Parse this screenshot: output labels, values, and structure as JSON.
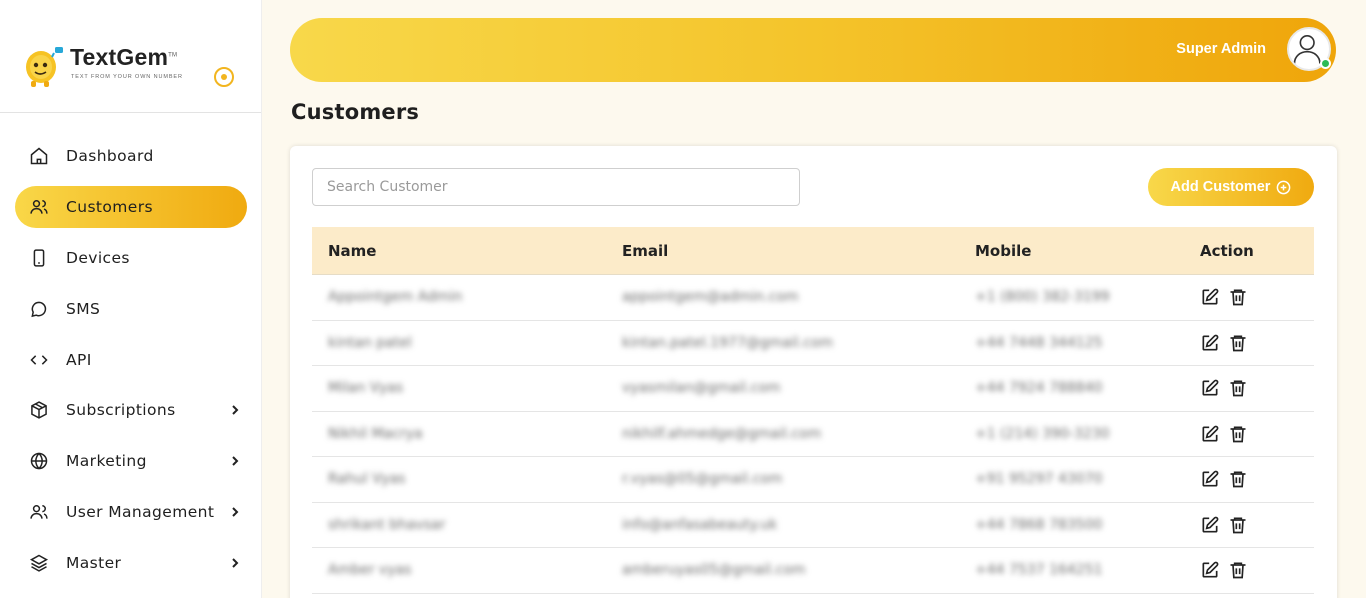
{
  "brand": {
    "name": "TextGem",
    "trademark": "TM",
    "tagline": "TEXT FROM YOUR OWN NUMBER",
    "accent": "#f2b51f"
  },
  "sidebar": {
    "items": [
      {
        "label": "Dashboard",
        "icon": "home-icon",
        "active": false,
        "has_submenu": false
      },
      {
        "label": "Customers",
        "icon": "users-icon",
        "active": true,
        "has_submenu": false
      },
      {
        "label": "Devices",
        "icon": "mobile-icon",
        "active": false,
        "has_submenu": false
      },
      {
        "label": "SMS",
        "icon": "chat-bubble-icon",
        "active": false,
        "has_submenu": false
      },
      {
        "label": "API",
        "icon": "code-icon",
        "active": false,
        "has_submenu": false
      },
      {
        "label": "Subscriptions",
        "icon": "box-icon",
        "active": false,
        "has_submenu": true
      },
      {
        "label": "Marketing",
        "icon": "globe-icon",
        "active": false,
        "has_submenu": true
      },
      {
        "label": "User Management",
        "icon": "users-icon",
        "active": false,
        "has_submenu": true
      },
      {
        "label": "Master",
        "icon": "layers-icon",
        "active": false,
        "has_submenu": true
      }
    ]
  },
  "header": {
    "user_name": "Super Admin",
    "user_status": "online"
  },
  "page": {
    "title": "Customers"
  },
  "toolbar": {
    "search_placeholder": "Search Customer",
    "search_value": "",
    "add_label": "Add Customer"
  },
  "table": {
    "columns": [
      "Name",
      "Email",
      "Mobile",
      "Action"
    ],
    "rows": [
      {
        "name": "Appointgem Admin",
        "email": "appointgem@admin.com",
        "mobile": "+1 (800) 382-3199"
      },
      {
        "name": "kintan patel",
        "email": "kintan.patel.1977@gmail.com",
        "mobile": "+44 7448 344125"
      },
      {
        "name": "Milan Vyas",
        "email": "vyasmilan@gmail.com",
        "mobile": "+44 7924 788840"
      },
      {
        "name": "Nikhil Macrya",
        "email": "nikhilf.ahmedge@gmail.com",
        "mobile": "+1 (214) 390-3230"
      },
      {
        "name": "Rahul Vyas",
        "email": "r.vyas@05@gmail.com",
        "mobile": "+91 95297 43070"
      },
      {
        "name": "shrikant bhavsar",
        "email": "info@anfasabeauty.uk",
        "mobile": "+44 7868 783500"
      },
      {
        "name": "Amber vyas",
        "email": "amberuyas05@gmail.com",
        "mobile": "+44 7537 164251"
      }
    ]
  }
}
